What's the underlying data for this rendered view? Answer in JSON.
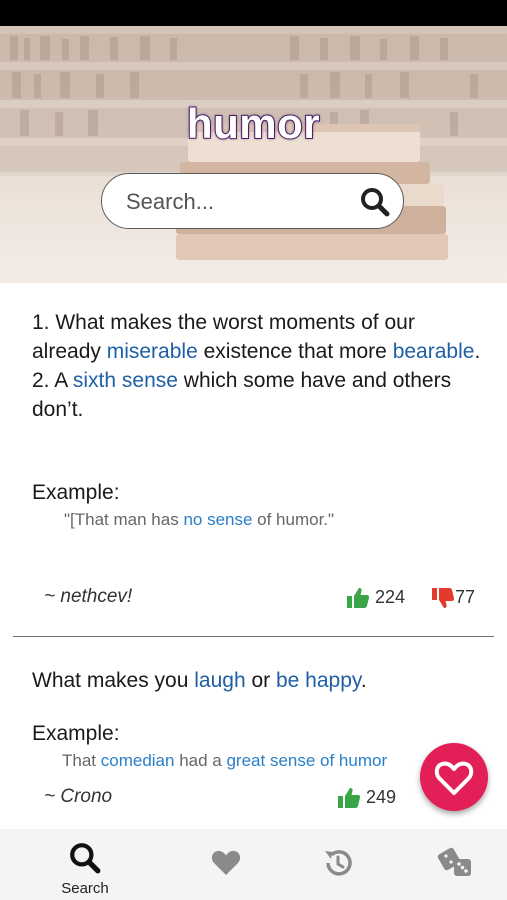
{
  "hero": {
    "title": "humor",
    "search_placeholder": "Search..."
  },
  "entries": [
    {
      "definition_parts": [
        {
          "text": "1.  What makes the worst moments of our already ",
          "link": false
        },
        {
          "text": "miserable",
          "link": true
        },
        {
          "text": " existence that more ",
          "link": false
        },
        {
          "text": "bearable",
          "link": true
        },
        {
          "text": ".",
          "link": false
        }
      ],
      "definition2_parts": [
        {
          "text": "2.  A ",
          "link": false
        },
        {
          "text": "sixth sense",
          "link": true
        },
        {
          "text": " which some have and others don’t.",
          "link": false
        }
      ],
      "example_label": "Example:",
      "example_parts": [
        {
          "text": "\"[That man has ",
          "link": false
        },
        {
          "text": "no sense",
          "link": true
        },
        {
          "text": " of humor.\"",
          "link": false
        }
      ],
      "author": "~ nethcev!",
      "upvotes": "224",
      "downvotes": "77"
    },
    {
      "definition_parts": [
        {
          "text": "What makes you ",
          "link": false
        },
        {
          "text": "laugh",
          "link": true
        },
        {
          "text": " or ",
          "link": false
        },
        {
          "text": "be happy",
          "link": true
        },
        {
          "text": ".",
          "link": false
        }
      ],
      "example_label": "Example:",
      "example_parts": [
        {
          "text": "That ",
          "link": false
        },
        {
          "text": "comedian",
          "link": true
        },
        {
          "text": " had a ",
          "link": false
        },
        {
          "text": "great sense of humor",
          "link": true
        }
      ],
      "author": "~ Crono",
      "upvotes": "249"
    }
  ],
  "tabs": [
    {
      "label": "Search",
      "icon": "search-icon",
      "active": true
    },
    {
      "label": "",
      "icon": "heart-icon",
      "active": false
    },
    {
      "label": "",
      "icon": "history-icon",
      "active": false
    },
    {
      "label": "",
      "icon": "dice-icon",
      "active": false
    }
  ],
  "colors": {
    "link": "#1f5fa5",
    "upvote": "#3aa547",
    "downvote": "#e23a2b",
    "fab": "#e21f56",
    "title_outline": "#4a1f6e"
  }
}
